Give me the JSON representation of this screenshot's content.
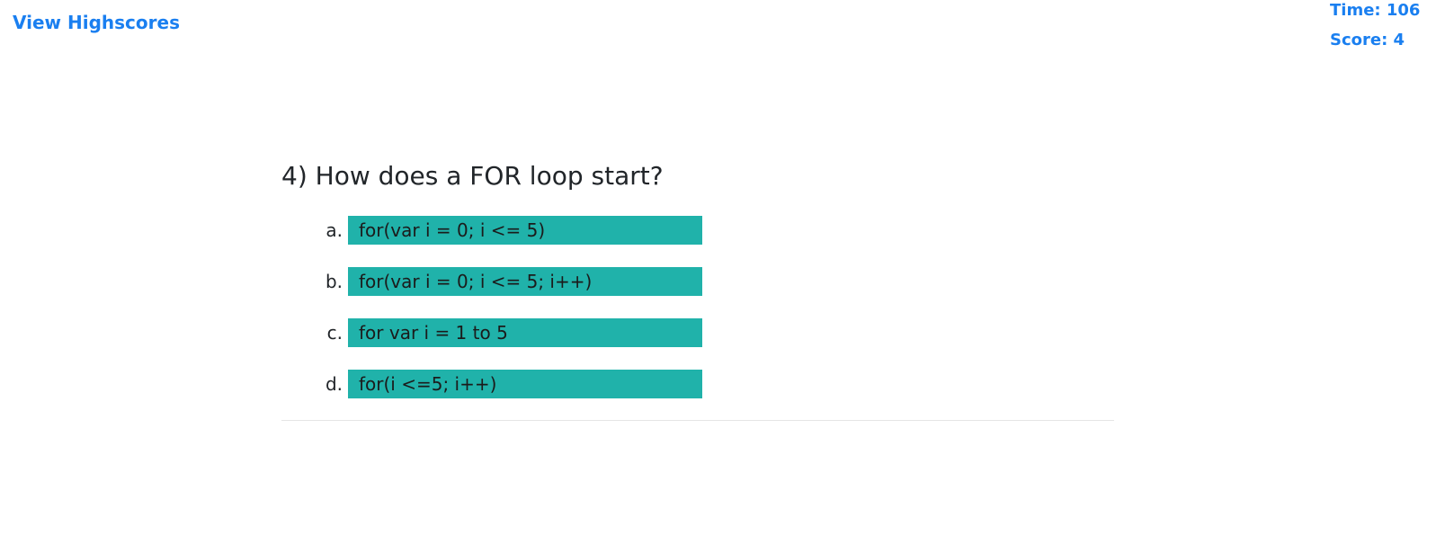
{
  "nav": {
    "highscores_label": "View Highscores"
  },
  "stats": {
    "time_label": "Time: 106",
    "score_label": "Score: 4"
  },
  "question": {
    "title": "4) How does a FOR loop start?",
    "answers": [
      {
        "letter": "a.",
        "text": "for(var i = 0; i <= 5)"
      },
      {
        "letter": "b.",
        "text": "for(var i = 0; i <= 5; i++)"
      },
      {
        "letter": "c.",
        "text": "for var i = 1 to 5"
      },
      {
        "letter": "d.",
        "text": "for(i <=5; i++)"
      }
    ]
  },
  "colors": {
    "link": "#1a7ff0",
    "answer_bg": "#20b2aa",
    "text": "#212529",
    "divider": "#e5e5e5"
  }
}
